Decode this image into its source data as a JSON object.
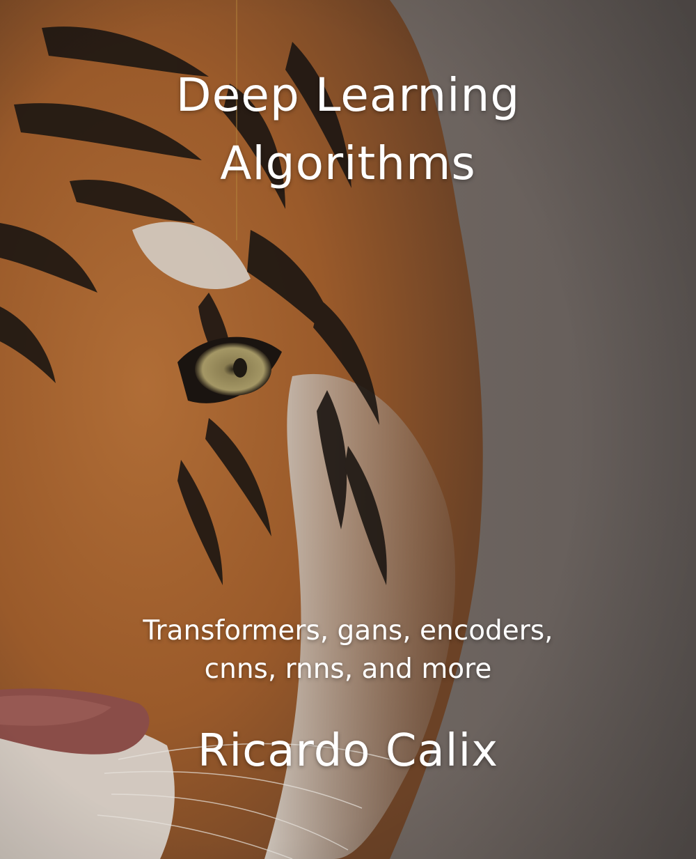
{
  "cover": {
    "title_line1": "Deep Learning",
    "title_line2": "Algorithms",
    "subtitle_line1": "Transformers, gans, encoders,",
    "subtitle_line2": "cnns, rnns, and more",
    "author": "Ricardo Calix"
  },
  "colors": {
    "background": "#6a6360",
    "fur_orange": "#a5642f",
    "stripe": "#1c1612",
    "white_fur": "#d6d2cc",
    "eye": "#8c7f52",
    "nose": "#8a4d48",
    "text": "#ffffff"
  }
}
